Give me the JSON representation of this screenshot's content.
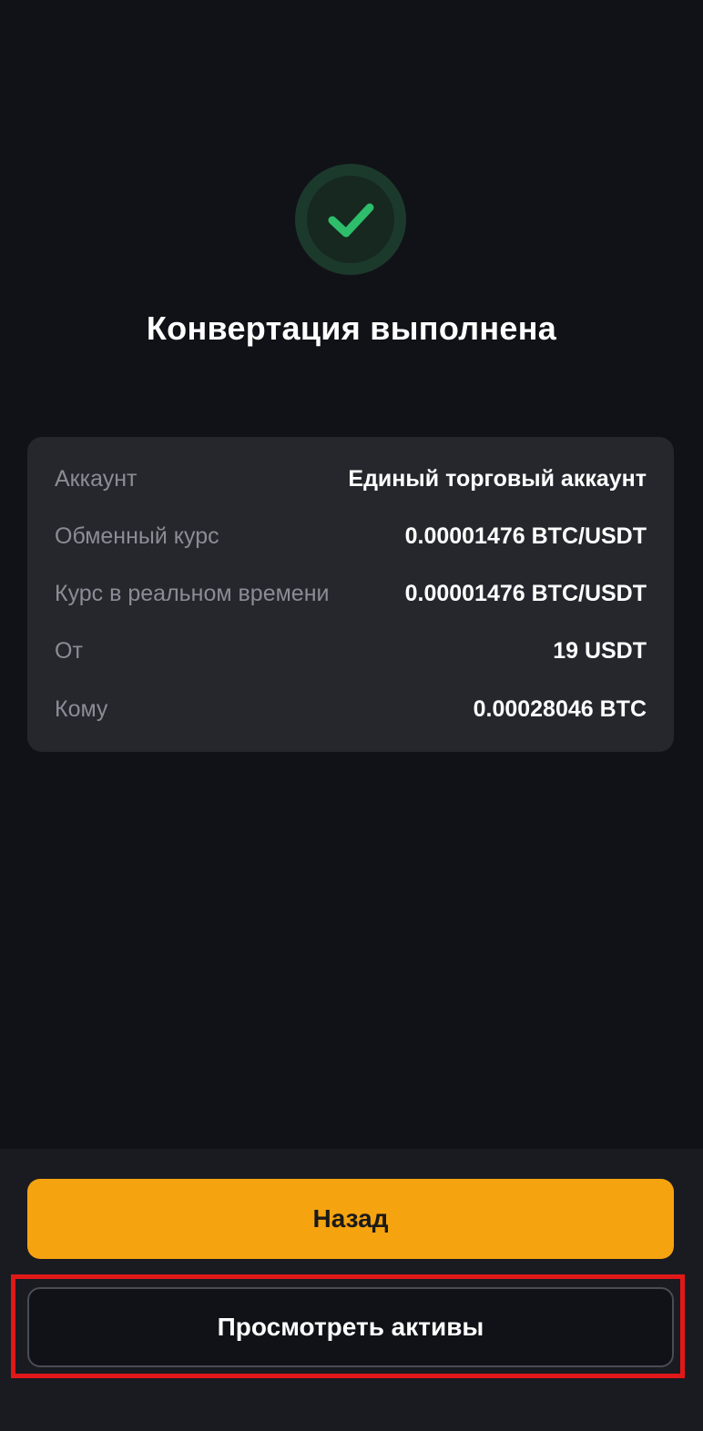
{
  "status": {
    "icon": "check-icon",
    "title": "Конвертация выполнена"
  },
  "details": [
    {
      "label": "Аккаунт",
      "value": "Единый торговый аккаунт"
    },
    {
      "label": "Обменный курс",
      "value": "0.00001476 BTC/USDT"
    },
    {
      "label": "Курс в реальном времени",
      "value": "0.00001476 BTC/USDT"
    },
    {
      "label": "От",
      "value": "19 USDT"
    },
    {
      "label": "Кому",
      "value": "0.00028046 BTC"
    }
  ],
  "actions": {
    "back_label": "Назад",
    "view_assets_label": "Просмотреть активы"
  },
  "colors": {
    "background": "#111217",
    "card": "#25272d",
    "success_green": "#2ebd6b",
    "primary_button": "#f5a30f",
    "highlight": "#e01818"
  }
}
